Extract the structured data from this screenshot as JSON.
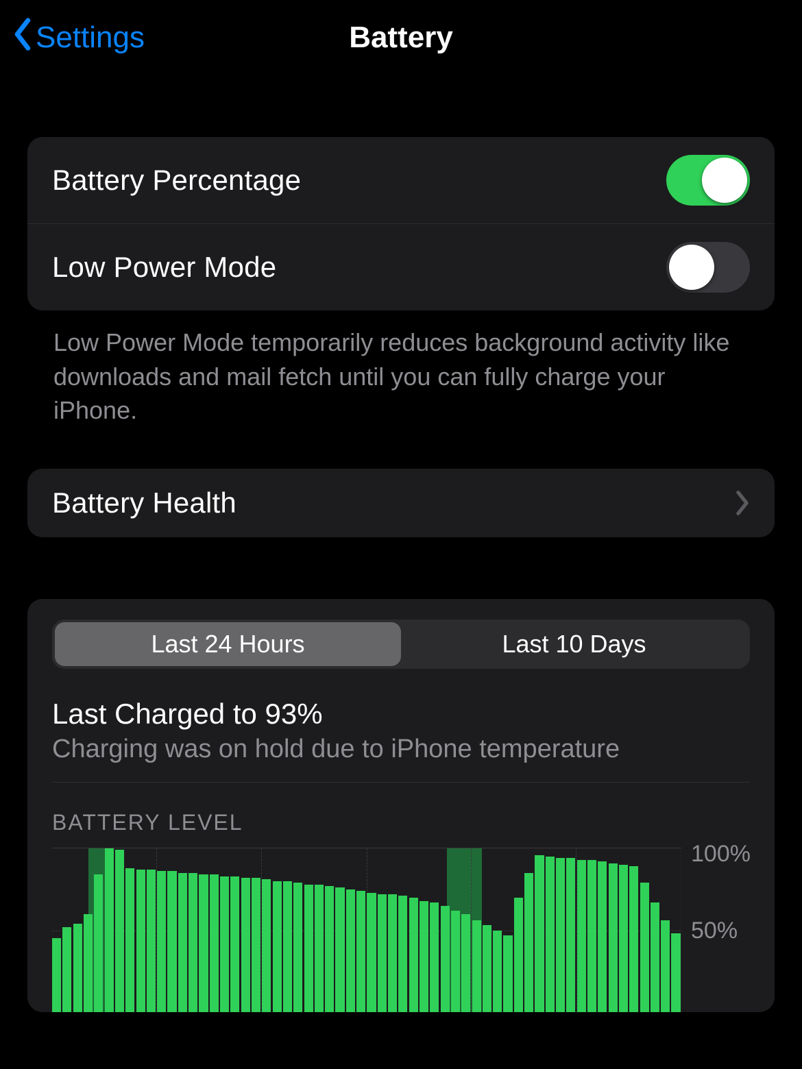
{
  "nav": {
    "back_label": "Settings",
    "title": "Battery"
  },
  "toggles": {
    "battery_percentage": {
      "label": "Battery Percentage",
      "on": true
    },
    "low_power_mode": {
      "label": "Low Power Mode",
      "on": false
    }
  },
  "low_power_footnote": "Low Power Mode temporarily reduces background activity like downloads and mail fetch until you can fully charge your iPhone.",
  "battery_health_label": "Battery Health",
  "seg": {
    "options": [
      "Last 24 Hours",
      "Last 10 Days"
    ],
    "active_index": 0
  },
  "last_charged": {
    "title": "Last Charged to 93%",
    "subtitle": "Charging was on hold due to iPhone temperature"
  },
  "chart_data": {
    "type": "bar",
    "title": "BATTERY LEVEL",
    "ylabel": "",
    "ylim": [
      0,
      100
    ],
    "y_ticks": [
      "100%",
      "50%"
    ],
    "vgrid_fractions": [
      0.166,
      0.333,
      0.5,
      0.666,
      0.833
    ],
    "charge_bands": [
      {
        "start": 0.058,
        "end": 0.088
      },
      {
        "start": 0.628,
        "end": 0.684
      }
    ],
    "values": [
      45,
      52,
      54,
      60,
      84,
      100,
      99,
      88,
      87,
      87,
      86,
      86,
      85,
      85,
      84,
      84,
      83,
      83,
      82,
      82,
      81,
      80,
      80,
      79,
      78,
      78,
      77,
      76,
      75,
      74,
      73,
      72,
      72,
      71,
      70,
      68,
      67,
      65,
      62,
      60,
      56,
      53,
      50,
      47,
      70,
      85,
      96,
      95,
      94,
      94,
      93,
      93,
      92,
      91,
      90,
      89,
      79,
      67,
      56,
      48
    ]
  }
}
